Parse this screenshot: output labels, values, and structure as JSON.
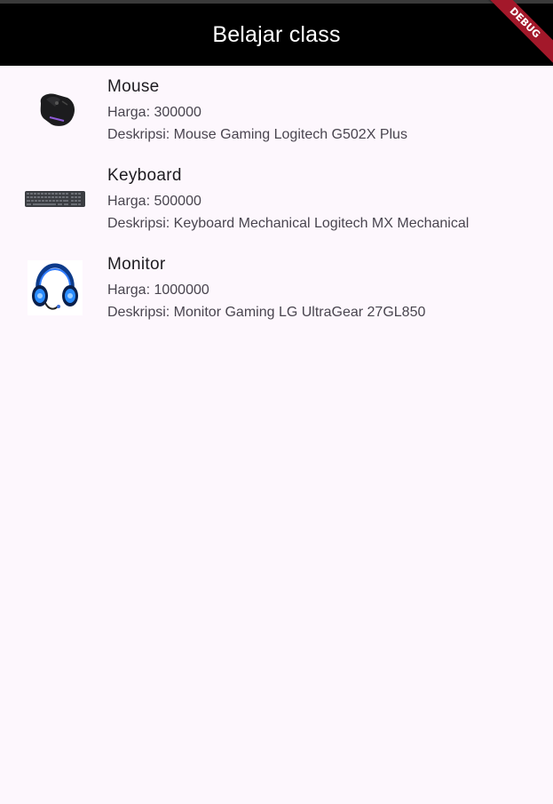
{
  "app_bar": {
    "title": "Belajar class",
    "background": "#000000"
  },
  "debug_banner": {
    "label": "DEBUG",
    "color": "#a3182a"
  },
  "products": [
    {
      "name": "Mouse",
      "price": "Harga: 300000",
      "description": "Deskripsi: Mouse Gaming Logitech G502X Plus",
      "image_icon": "gaming-mouse-image"
    },
    {
      "name": "Keyboard",
      "price": "Harga: 500000",
      "description": "Deskripsi: Keyboard Mechanical Logitech MX Mechanical",
      "image_icon": "keyboard-image"
    },
    {
      "name": "Monitor",
      "price": "Harga: 1000000",
      "description": "Deskripsi: Monitor Gaming LG UltraGear 27GL850",
      "image_icon": "gaming-headset-image"
    }
  ]
}
